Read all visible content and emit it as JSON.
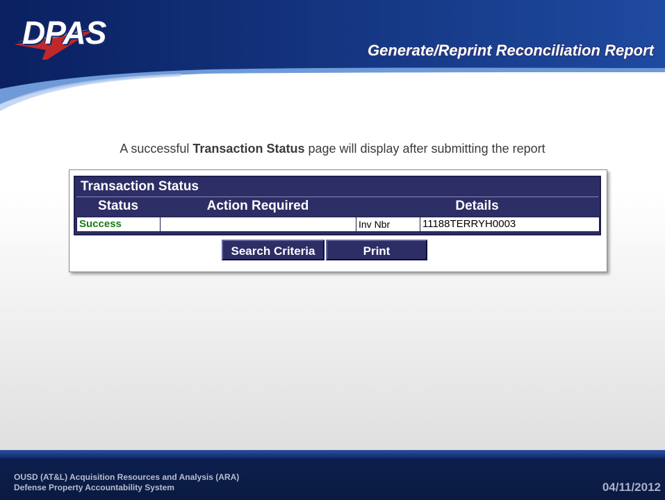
{
  "header": {
    "logo_text": "DPAS",
    "page_title": "Generate/Reprint Reconciliation Report"
  },
  "intro": {
    "prefix": "A successful ",
    "bold": "Transaction Status",
    "suffix": " page will display after submitting the report"
  },
  "transaction_status": {
    "title": "Transaction Status",
    "columns": {
      "status": "Status",
      "action_required": "Action Required",
      "details": "Details"
    },
    "row": {
      "status": "Success",
      "action_required": "",
      "detail_label": "Inv Nbr",
      "detail_value": "11188TERRYH0003"
    }
  },
  "buttons": {
    "search_criteria": "Search Criteria",
    "print": "Print"
  },
  "footer": {
    "line1": "OUSD (AT&L) Acquisition Resources and Analysis (ARA)",
    "line2": "Defense Property Accountability System",
    "date": "04/11/2012"
  },
  "colors": {
    "header_blue": "#1e3c8c",
    "panel_navy": "#2e2e66",
    "success_green": "#1a7a1a"
  }
}
